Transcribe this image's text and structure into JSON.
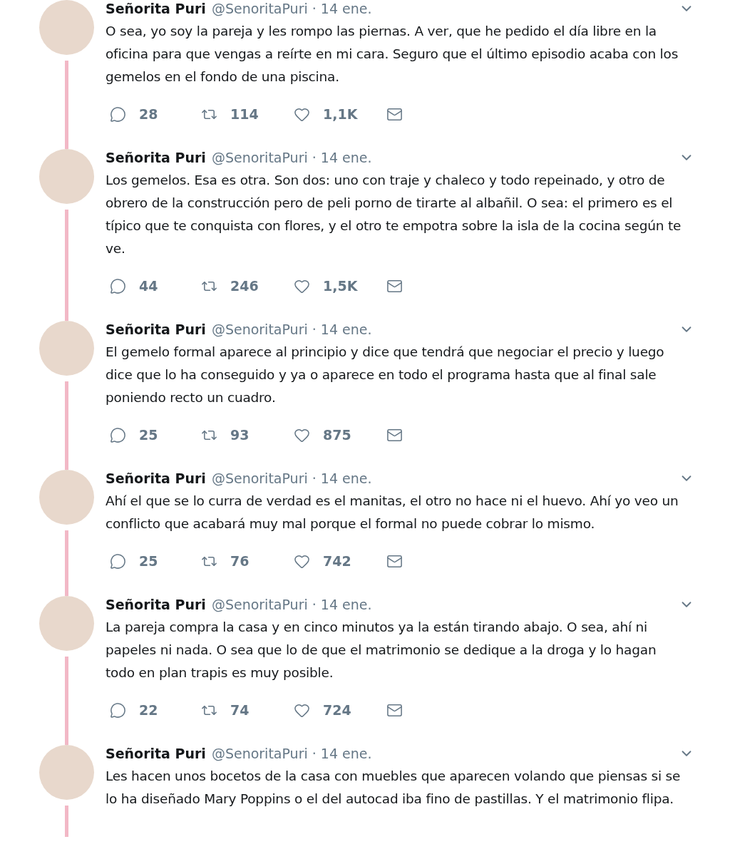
{
  "tweets": [
    {
      "name": "Señorita Puri",
      "handle": "@SenoritaPuri",
      "date": "· 14 ene.",
      "text": "O sea, yo soy la pareja y les rompo las piernas. A ver, que he pedido el día libre en la oficina para que vengas a reírte en mi cara. Seguro que el último episodio acaba con los gemelos en el fondo de una piscina.",
      "thread_line": true,
      "stats": {
        "replies": "28",
        "retweets": "114",
        "likes": "1,1K"
      }
    },
    {
      "name": "Señorita Puri",
      "handle": "@SenoritaPuri",
      "date": "· 14 ene.",
      "text": "Los gemelos. Esa es otra. Son dos: uno con traje y chaleco y todo repeinado, y otro de obrero de la construcción pero de peli porno de tirarte al albañil. O sea: el primero es el típico que te conquista con flores, y el otro te empotra sobre la isla de la cocina según te ve.",
      "thread_line": true,
      "stats": {
        "replies": "44",
        "retweets": "246",
        "likes": "1,5K"
      }
    },
    {
      "name": "Señorita Puri",
      "handle": "@SenoritaPuri",
      "date": "· 14 ene.",
      "text": "El gemelo formal aparece al principio y dice que tendrá que negociar el precio y luego dice que lo ha conseguido y ya o aparece en todo el programa hasta que al final sale poniendo recto un cuadro.",
      "thread_line": true,
      "stats": {
        "replies": "25",
        "retweets": "93",
        "likes": "875"
      }
    },
    {
      "name": "Señorita Puri",
      "handle": "@SenoritaPuri",
      "date": "· 14 ene.",
      "text": "Ahí el que se lo curra de verdad es el manitas, el otro no hace ni el huevo. Ahí yo veo un conflicto que acabará muy mal porque el formal no puede cobrar lo mismo.",
      "thread_line": true,
      "stats": {
        "replies": "25",
        "retweets": "76",
        "likes": "742"
      }
    },
    {
      "name": "Señorita Puri",
      "handle": "@SenoritaPuri",
      "date": "· 14 ene.",
      "text": "La pareja compra la casa y en cinco minutos ya la están tirando abajo. O sea, ahí ni papeles ni nada. O sea que lo de que el matrimonio se dedique a la droga y lo hagan todo en plan trapis es muy posible.",
      "thread_line": true,
      "stats": {
        "replies": "22",
        "retweets": "74",
        "likes": "724"
      }
    },
    {
      "name": "Señorita Puri",
      "handle": "@SenoritaPuri",
      "date": "· 14 ene.",
      "text": "Les hacen unos bocetos de la casa con muebles que aparecen volando que piensas si se lo ha diseñado Mary Poppins o el del autocad iba fino de pastillas. Y el matrimonio flipa.",
      "thread_line": true
    }
  ]
}
